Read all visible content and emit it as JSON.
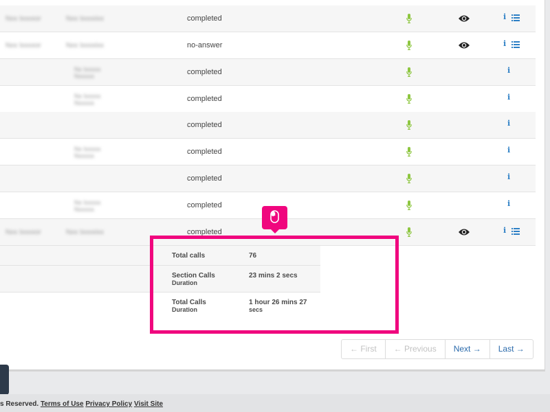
{
  "table": {
    "rows": [
      {
        "col1": "Nxx Ixxxxor",
        "col2": "Nxx Ixxxxixx",
        "status": "completed",
        "eye": true,
        "list": true
      },
      {
        "col1": "Nxx Ixxxxor",
        "col2": "Nxx Ixxxxixx",
        "status": "no-answer",
        "eye": true,
        "list": true
      },
      {
        "col1": "",
        "col2": "Nx Ixxxxx Nxxxxx",
        "status": "completed",
        "eye": false,
        "list": false
      },
      {
        "col1": "",
        "col2": "Nx Ixxxxx Nxxxxx",
        "status": "completed",
        "eye": false,
        "list": false
      },
      {
        "col1": "",
        "col2": "",
        "status": "completed",
        "eye": false,
        "list": false
      },
      {
        "col1": "",
        "col2": "Nx Ixxxxx Nxxxxx",
        "status": "completed",
        "eye": false,
        "list": false
      },
      {
        "col1": "",
        "col2": "",
        "status": "completed",
        "eye": false,
        "list": false
      },
      {
        "col1": "",
        "col2": "Nx Ixxxxx Nxxxxx",
        "status": "completed",
        "eye": false,
        "list": false
      },
      {
        "col1": "Nxx Ixxxxor",
        "col2": "Nxx Ixxxxixx",
        "status": "completed",
        "eye": true,
        "list": true
      }
    ]
  },
  "summary": {
    "total_calls_label": "Total calls",
    "total_calls_value": "76",
    "section_calls_label_1": "Section Calls",
    "section_calls_label_2": "Duration",
    "section_calls_value": "23 mins 2 secs",
    "total_duration_label_1": "Total Calls",
    "total_duration_label_2": "Duration",
    "total_duration_value_1": "1 hour 26 mins 27",
    "total_duration_value_2": "secs"
  },
  "pagination": {
    "first": "← First",
    "previous": "← Previous",
    "next": "Next →",
    "last": "Last →"
  },
  "footer": {
    "reserved": "s Reserved.",
    "terms": "Terms of Use",
    "privacy": "Privacy Policy",
    "visit": "Visit Site"
  },
  "colors": {
    "highlight": "#f0067e",
    "mic": "#8dc63f",
    "info": "#2c7fc5",
    "link": "#2a6aab"
  },
  "icons": {
    "mic": "microphone-icon",
    "eye": "eye-icon",
    "info": "info-icon",
    "list": "list-icon",
    "cursor": "mouse-cursor-icon"
  }
}
